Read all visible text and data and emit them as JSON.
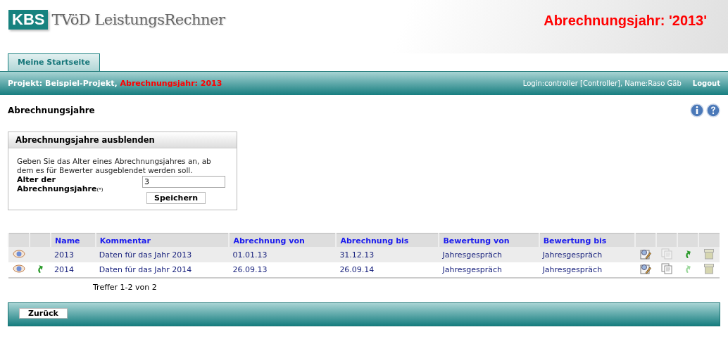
{
  "header": {
    "logo_badge": "KBS",
    "logo_text": "TVöD LeistungsRechner",
    "year_banner": "Abrechnungsjahr: '2013'"
  },
  "tabs": [
    {
      "label": "Meine Startseite",
      "selected": true
    }
  ],
  "project_bar": {
    "project": "Projekt: Beispiel-Projekt,",
    "year": "Abrechnungsjahr: 2013",
    "login": "Login:controller [Controller], Name:Raso Gäb",
    "logout": "Logout"
  },
  "page_title": "Abrechnungsjahre",
  "hide_panel": {
    "title": "Abrechnungsjahre ausblenden",
    "description": "Geben Sie das Alter eines Abrechnungsjahres an, ab dem es für Bewerter ausgeblendet werden soll.",
    "field_label": "Alter der Abrechnungsjahre$_{(*)}$",
    "field_value": "3",
    "save_button": "Speichern"
  },
  "table": {
    "columns": [
      "Name",
      "Kommentar",
      "Abrechnung von",
      "Abrechnung bis",
      "Bewertung von",
      "Bewertung bis"
    ],
    "rows": [
      {
        "switch_shown": false,
        "cells": [
          "2013",
          "Daten für das Jahr 2013",
          "01.01.13",
          "31.12.13",
          "Jahresgespräch",
          "Jahresgespräch"
        ],
        "actions": [
          {
            "kind": "edit",
            "disabled": false
          },
          {
            "kind": "copy",
            "disabled": true
          },
          {
            "kind": "forward",
            "disabled": false
          },
          {
            "kind": "archive",
            "disabled": false
          }
        ]
      },
      {
        "switch_shown": true,
        "cells": [
          "2014",
          "Daten für das Jahr 2014",
          "26.09.13",
          "26.09.14",
          "Jahresgespräch",
          "Jahresgespräch"
        ],
        "actions": [
          {
            "kind": "edit",
            "disabled": false
          },
          {
            "kind": "copy",
            "disabled": false
          },
          {
            "kind": "forward",
            "disabled": true
          },
          {
            "kind": "archive",
            "disabled": false
          }
        ]
      }
    ],
    "hits": "Treffer 1-2 von 2"
  },
  "footer": {
    "back_button": "Zurück"
  }
}
